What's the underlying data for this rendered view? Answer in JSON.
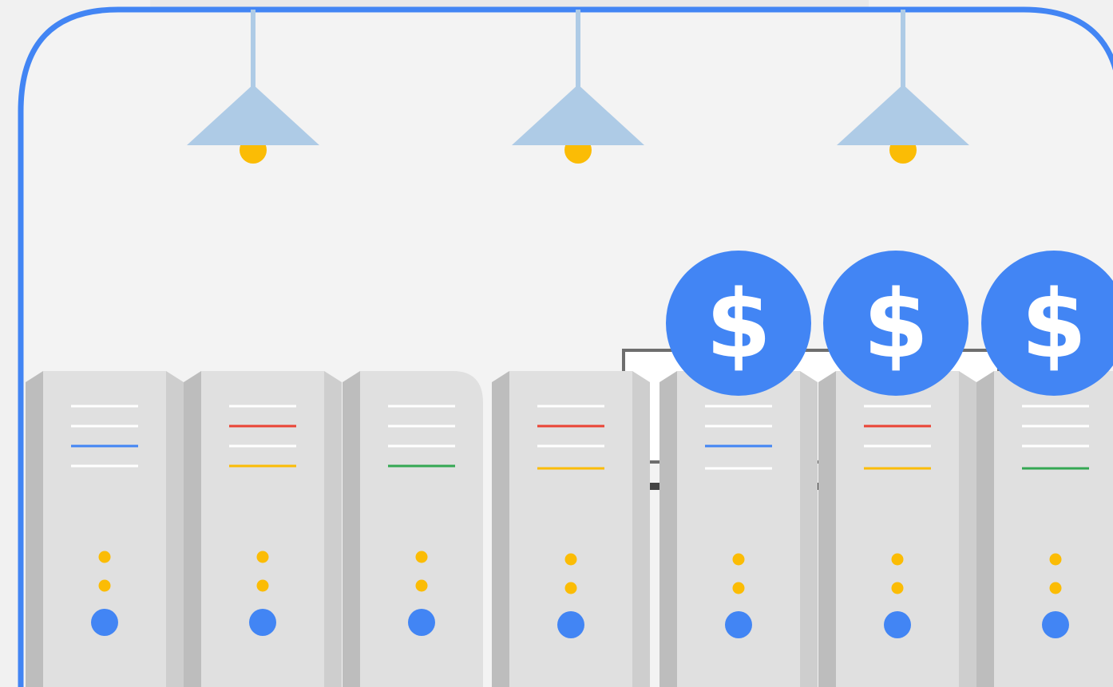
{
  "colors": {
    "background": "#f1f1f1",
    "room_fill": "#f3f3f3",
    "room_border": "#4285f4",
    "lamp_shade": "#aecbe6",
    "bulb": "#fbbc05",
    "server_front": "#e0e0e0",
    "server_side_left": "#bdbdbd",
    "server_side_right": "#cecece",
    "line_white": "#ffffff",
    "line_blue": "#4285f4",
    "line_red": "#ea4335",
    "line_yellow": "#fbbc05",
    "line_green": "#34a853",
    "indicator_yellow": "#fbbc05",
    "power_blue": "#4285f4",
    "coin": "#4285f4",
    "coin_symbol": "#ffffff"
  },
  "scene": {
    "lamp_count": 3,
    "coins": [
      {
        "symbol": "$",
        "icon": "dollar-coin-icon"
      },
      {
        "symbol": "$",
        "icon": "dollar-coin-icon"
      },
      {
        "symbol": "$",
        "icon": "dollar-coin-icon"
      }
    ],
    "servers": [
      {
        "accent_lines": [
          "white",
          "white",
          "blue",
          "white"
        ]
      },
      {
        "accent_lines": [
          "white",
          "red",
          "white",
          "yellow"
        ]
      },
      {
        "accent_lines": [
          "white",
          "white",
          "white",
          "green"
        ]
      },
      {
        "accent_lines": [
          "white",
          "red",
          "white",
          "yellow"
        ]
      },
      {
        "accent_lines": [
          "white",
          "white",
          "blue",
          "white"
        ]
      },
      {
        "accent_lines": [
          "white",
          "red",
          "white",
          "yellow"
        ]
      },
      {
        "accent_lines": [
          "white",
          "white",
          "white",
          "green"
        ]
      }
    ]
  }
}
